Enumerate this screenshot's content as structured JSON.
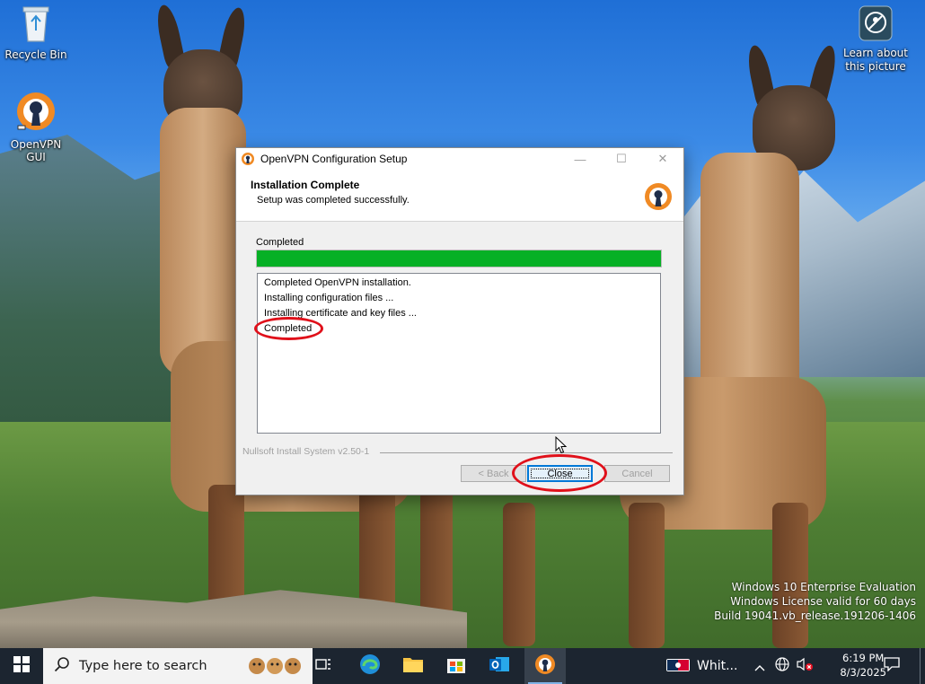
{
  "desktop": {
    "icons": [
      {
        "label": "Recycle Bin"
      },
      {
        "label": "OpenVPN GUI"
      },
      {
        "label": "Learn about this picture"
      }
    ],
    "watermark": {
      "line1": "Windows 10 Enterprise Evaluation",
      "line2": "Windows License valid for 60 days",
      "line3": "Build 19041.vb_release.191206-1406"
    }
  },
  "dialog": {
    "title": "OpenVPN Configuration Setup",
    "header_title": "Installation Complete",
    "header_subtitle": "Setup was completed successfully.",
    "status_text": "Completed",
    "progress": 1.0,
    "log_lines": [
      "Completed OpenVPN installation.",
      "Installing configuration files ...",
      "Installing certificate and key files ...",
      "Completed"
    ],
    "branding": "Nullsoft Install System v2.50-1",
    "buttons": {
      "back": "< Back",
      "close": "Close",
      "cancel": "Cancel"
    },
    "colors": {
      "progress_fill": "#06b025",
      "annotation": "#e0101a"
    }
  },
  "taskbar": {
    "search_placeholder": "Type here to search",
    "weather_text": "Whit...",
    "time": "6:19 PM",
    "date": "8/3/2025",
    "apps": [
      "task-view",
      "edge",
      "file-explorer",
      "microsoft-store",
      "outlook",
      "openvpn"
    ]
  }
}
